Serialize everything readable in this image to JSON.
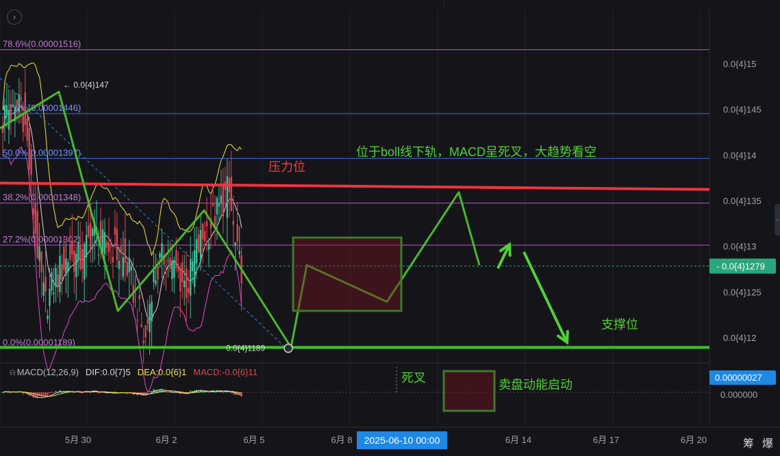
{
  "colors": {
    "background": "#151519",
    "up": "#3fbf9a",
    "down": "#e0434f",
    "fib": "#c44dd3",
    "fib_blue": "#3a6cf0",
    "resistance": "#f0343f",
    "support": "#3ec22b",
    "wave": "#4bb82e",
    "boll_upper": "#f2e640",
    "boll_mid": "#d8d8d8",
    "boll_lower": "#e64ac9",
    "price_tag": "#2aa67d",
    "macd_tag": "#1e88e5",
    "annotation_green": "#4fd136",
    "annotation_red": "#ff3a3a"
  },
  "toolbar": {
    "collapse_icon": "chevron-right-icon"
  },
  "chart_data": {
    "type": "candlestick",
    "x_ticks": [
      "5月 30",
      "6月 2",
      "6月 5",
      "6月 8",
      "6月 14",
      "6月 17",
      "6月 20"
    ],
    "crosshair_date": "2025-06-10 00:00",
    "y_ticks": [
      "0.0{4}15",
      "0.0{4}145",
      "0.0{4}14",
      "0.0{4}135",
      "0.0{4}13",
      "0.0{4}125",
      "0.0{4}12"
    ],
    "y_tick_values": [
      1.5e-05,
      1.45e-05,
      1.4e-05,
      1.35e-05,
      1.3e-05,
      1.25e-05,
      1.2e-05
    ],
    "ylim": [
      1.173e-05,
      1.56e-05
    ],
    "current_price_label": "0.0{4}1279",
    "current_price": 1.279e-05,
    "high_marker": {
      "label": "0.0{4}147",
      "value": 1.47e-05
    },
    "low_marker": {
      "label": "0.0{4}1189",
      "value": 1.189e-05
    },
    "fib_levels": [
      {
        "label": "78.6%(0.00001516)",
        "value": 1.516e-05
      },
      {
        "label": "61.8%(0.00001446)",
        "value": 1.446e-05
      },
      {
        "label": "50.0%(0.00001397)",
        "value": 1.397e-05
      },
      {
        "label": "38.2%(0.00001348)",
        "value": 1.348e-05
      },
      {
        "label": "27.2%(0.00001302)",
        "value": 1.302e-05
      },
      {
        "label": "0.0%(0.00001189)",
        "value": 1.189e-05
      }
    ],
    "annotations": {
      "resistance": "压力位",
      "support": "支撑位",
      "summary": "位于boll线下轨，MACD呈死叉，大趋势看空",
      "death_cross": "死叉",
      "selling_momentum": "卖盘动能启动"
    },
    "macd": {
      "title": "MACD(12,26,9)",
      "dif": "DIF:0.0{7}5",
      "dea": "DEA:0.0{6}1",
      "macd": "MACD:-0.0{6}11",
      "tag": "0.00000027",
      "zero_label": "0.000000"
    }
  },
  "bottom_tools": [
    "筹",
    "爆"
  ]
}
